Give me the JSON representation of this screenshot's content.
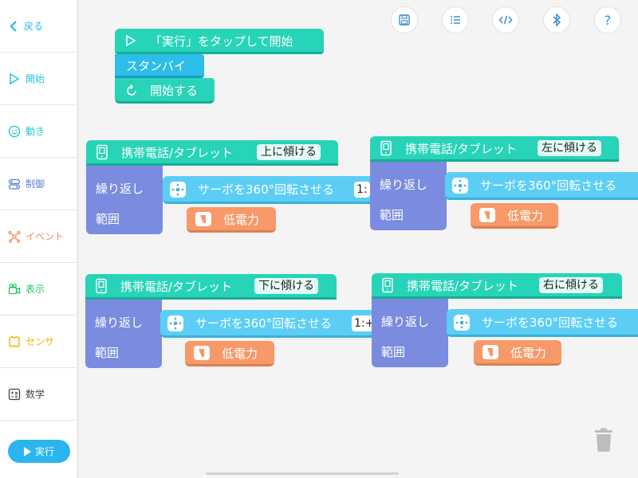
{
  "sidebar": {
    "back": "戻る",
    "start": "開始",
    "motion": "動き",
    "control": "制御",
    "event": "イベント",
    "display": "表示",
    "sensor": "センサ",
    "math": "数学",
    "run": "実行"
  },
  "colors": {
    "start": "#27c8d0",
    "motion": "#27c8d0",
    "control": "#5b7fd9",
    "event": "#f08a56",
    "display": "#27c466",
    "sensor": "#f5b400",
    "math": "#444444",
    "run": "#2ab5ee"
  },
  "toolbar": {
    "save_icon": "save-icon",
    "list_icon": "list-icon",
    "code_icon": "code-icon",
    "bluetooth_icon": "bluetooth-icon",
    "help_label": "?"
  },
  "start_block": {
    "title": "「実行」をタップして開始",
    "standby": "スタンバイ",
    "begin": "開始する"
  },
  "tilt_blocks": [
    {
      "device": "携帯電話/タブレット",
      "direction": "上に傾ける",
      "repeat": "繰り返し",
      "servo": "サーボを360°回転させる",
      "servo_value": "1:",
      "range": "範囲",
      "power": "低電力"
    },
    {
      "device": "携帯電話/タブレット",
      "direction": "左に傾ける",
      "repeat": "繰り返し",
      "servo": "サーボを360°回転させる",
      "servo_value": "",
      "range": "範囲",
      "power": "低電力"
    },
    {
      "device": "携帯電話/タブレット",
      "direction": "下に傾ける",
      "repeat": "繰り返し",
      "servo": "サーボを360°回転させる",
      "servo_value": "1:+",
      "range": "範囲",
      "power": "低電力"
    },
    {
      "device": "携帯電話/タブレット",
      "direction": "右に傾ける",
      "repeat": "繰り返し",
      "servo": "サーボを360°回転させる",
      "servo_value": "",
      "range": "範囲",
      "power": "低電力"
    }
  ]
}
